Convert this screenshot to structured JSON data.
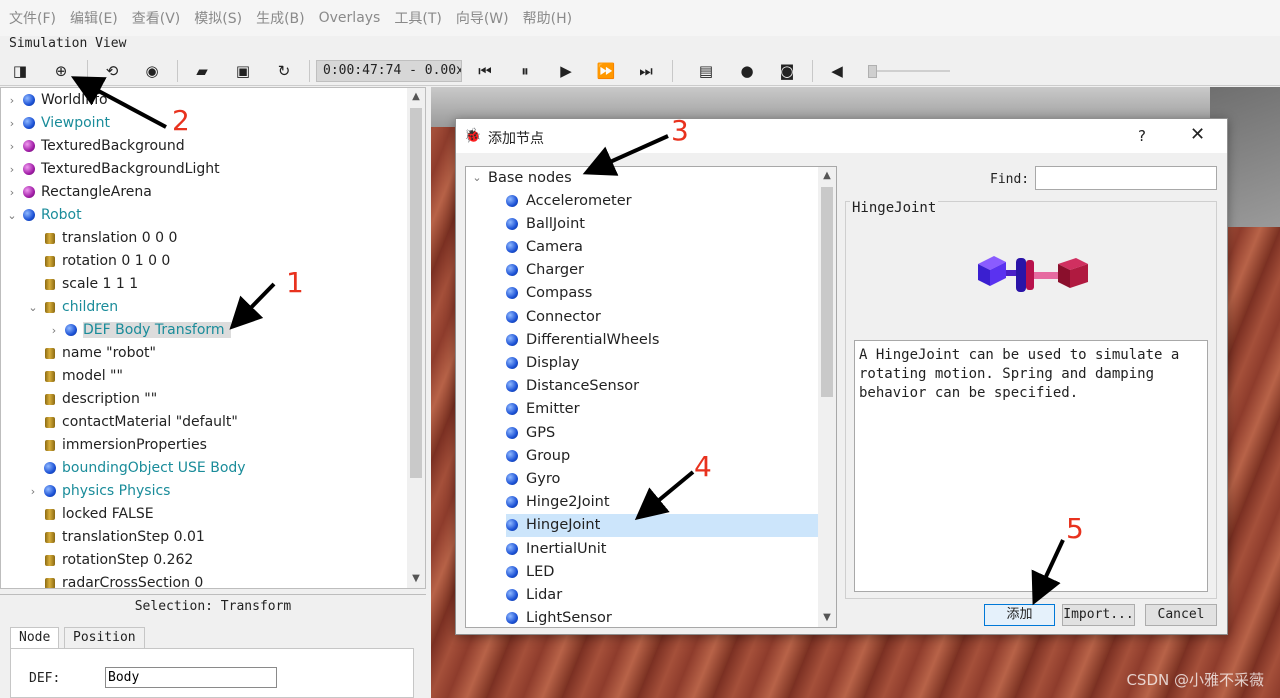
{
  "menu": [
    "文件(F)",
    "编辑(E)",
    "查看(V)",
    "模拟(S)",
    "生成(B)",
    "Overlays",
    "工具(T)",
    "向导(W)",
    "帮助(H)"
  ],
  "sim_view_title": "Simulation View",
  "toolbar": {
    "time": "0:00:47:74 - 0.00x",
    "icons": [
      "panel-toggle-icon",
      "add-node-icon",
      "revert-icon",
      "eye-icon",
      "open-folder-icon",
      "save-icon",
      "reload-icon",
      "step-back-icon",
      "pause-icon",
      "play-icon",
      "fast-forward-icon",
      "fastest-icon",
      "record-movie-icon",
      "record-icon",
      "screenshot-icon",
      "mute-icon"
    ]
  },
  "scene_tree": {
    "items": [
      {
        "label": "WorldInfo",
        "kind": "blue",
        "arrow": "›",
        "teal": false
      },
      {
        "label": "Viewpoint",
        "kind": "blue",
        "arrow": "›",
        "teal": true
      },
      {
        "label": "TexturedBackground",
        "kind": "purple",
        "arrow": "›",
        "teal": false
      },
      {
        "label": "TexturedBackgroundLight",
        "kind": "purple",
        "arrow": "›",
        "teal": false
      },
      {
        "label": "RectangleArena",
        "kind": "purple",
        "arrow": "›",
        "teal": false
      },
      {
        "label": "Robot",
        "kind": "blue",
        "arrow": "⌄",
        "teal": true
      },
      {
        "label": "translation 0 0 0",
        "kind": "field"
      },
      {
        "label": "rotation 0 1 0 0",
        "kind": "field"
      },
      {
        "label": "scale 1 1 1",
        "kind": "field"
      },
      {
        "label": "children",
        "kind": "field",
        "arrow": "⌄",
        "teal": true
      },
      {
        "label": "DEF Body Transform",
        "kind": "blue",
        "arrow": "›",
        "teal": true,
        "selected": true
      },
      {
        "label": "name \"robot\"",
        "kind": "field"
      },
      {
        "label": "model \"\"",
        "kind": "field"
      },
      {
        "label": "description \"\"",
        "kind": "field"
      },
      {
        "label": "contactMaterial \"default\"",
        "kind": "field"
      },
      {
        "label": "immersionProperties",
        "kind": "field"
      },
      {
        "label": "boundingObject USE Body",
        "kind": "blue",
        "teal": true
      },
      {
        "label": "physics Physics",
        "kind": "blue",
        "arrow": "›",
        "teal": true
      },
      {
        "label": "locked FALSE",
        "kind": "field"
      },
      {
        "label": "translationStep 0.01",
        "kind": "field"
      },
      {
        "label": "rotationStep 0.262",
        "kind": "field"
      },
      {
        "label": "radarCrossSection 0",
        "kind": "field"
      }
    ]
  },
  "selection": {
    "title": "Selection: Transform",
    "tabs": [
      "Node",
      "Position"
    ],
    "def_label": "DEF:",
    "def_value": "Body"
  },
  "dialog": {
    "title": "添加节点",
    "help": "?",
    "close": "✕",
    "group": "Base nodes",
    "nodes": [
      "Accelerometer",
      "BallJoint",
      "Camera",
      "Charger",
      "Compass",
      "Connector",
      "DifferentialWheels",
      "Display",
      "DistanceSensor",
      "Emitter",
      "GPS",
      "Group",
      "Gyro",
      "Hinge2Joint",
      "HingeJoint",
      "InertialUnit",
      "LED",
      "Lidar",
      "LightSensor"
    ],
    "selected": "HingeJoint",
    "find_label": "Find:",
    "find_value": "",
    "preview_title": "HingeJoint",
    "description": "A HingeJoint can be used to simulate a rotating motion. Spring and damping behavior can be specified.",
    "buttons": {
      "add": "添加",
      "import": "Import...",
      "cancel": "Cancel"
    }
  },
  "annotations": [
    "1",
    "2",
    "3",
    "4",
    "5"
  ],
  "watermark": "CSDN @小雅不采薇",
  "colors": {
    "teal": "#1a8c9a",
    "selection": "#cce5fb",
    "annotation": "#e8321e"
  }
}
